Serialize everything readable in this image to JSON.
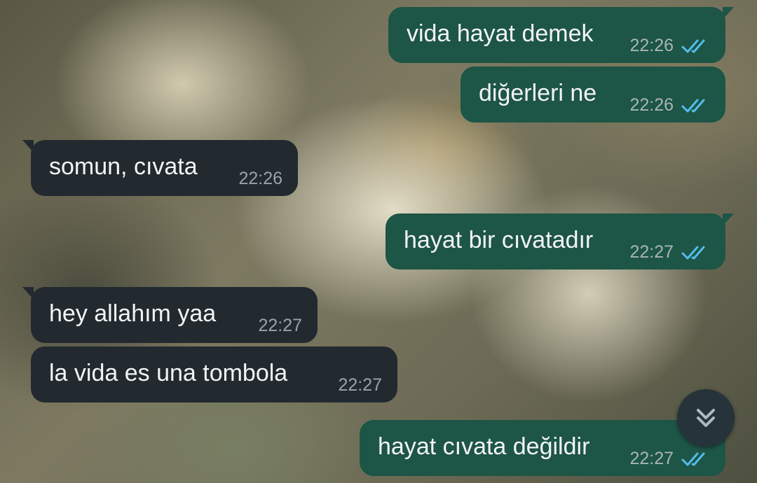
{
  "chat": {
    "messages": [
      {
        "direction": "outgoing",
        "text": "vida hayat demek",
        "time": "22:26",
        "status": "read"
      },
      {
        "direction": "outgoing",
        "text": "diğerleri ne",
        "time": "22:26",
        "status": "read"
      },
      {
        "direction": "incoming",
        "text": "somun, cıvata",
        "time": "22:26"
      },
      {
        "direction": "outgoing",
        "text": "hayat bir cıvatadır",
        "time": "22:27",
        "status": "read"
      },
      {
        "direction": "incoming",
        "text": "hey allahım yaa",
        "time": "22:27"
      },
      {
        "direction": "incoming",
        "text": "la vida es una tombola",
        "time": "22:27"
      },
      {
        "direction": "outgoing",
        "text": "hayat cıvata değildir",
        "time": "22:27",
        "status": "read"
      }
    ]
  },
  "scroll_button": {
    "icon": "double-chevron-down-icon"
  },
  "colors": {
    "outgoing_bubble": "#1d5546",
    "incoming_bubble": "#222a30",
    "read_ticks": "#53bdeb",
    "text": "#f2f4f5",
    "timestamp": "#a8b6b2"
  }
}
